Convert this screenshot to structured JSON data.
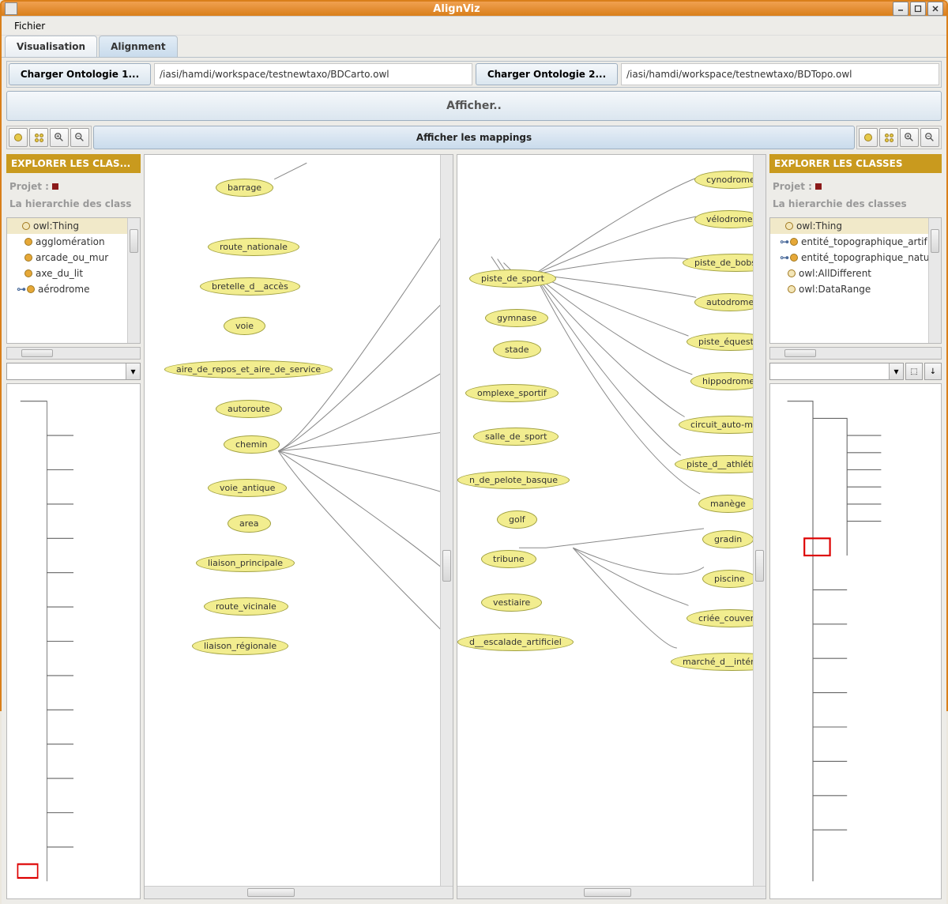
{
  "window": {
    "title": "AlignViz"
  },
  "menubar": {
    "file": "Fichier"
  },
  "tabs": {
    "visualisation": "Visualisation",
    "alignment": "Alignment",
    "active": "alignment"
  },
  "loaders": {
    "btn1": "Charger Ontologie 1...",
    "path1": "/iasi/hamdi/workspace/testnewtaxo/BDCarto.owl",
    "btn2": "Charger Ontologie 2...",
    "path2": "/iasi/hamdi/workspace/testnewtaxo/BDTopo.owl"
  },
  "buttons": {
    "afficher": "Afficher..",
    "mappings": "Afficher les mappings"
  },
  "explorer_left": {
    "header": "EXPLORER LES CLAS...",
    "projet": "Projet :",
    "hierarchy": "La hierarchie des class",
    "items": [
      "owl:Thing",
      "agglomération",
      "arcade_ou_mur",
      "axe_du_lit",
      "aérodrome"
    ]
  },
  "explorer_right": {
    "header": "EXPLORER LES CLASSES",
    "projet": "Projet :",
    "hierarchy": "La hierarchie des classes",
    "items": [
      "owl:Thing",
      "entité_topographique_artif",
      "entité_topographique_natu",
      "owl:AllDifferent",
      "owl:DataRange"
    ]
  },
  "graph_left": {
    "nodes": [
      "barrage",
      "route_nationale",
      "bretelle_d__accès",
      "voie",
      "aire_de_repos_et_aire_de_service",
      "autoroute",
      "chemin",
      "voie_antique",
      "area",
      "liaison_principale",
      "route_vicinale",
      "liaison_régionale"
    ]
  },
  "graph_right_col1": {
    "nodes": [
      "piste_de_sport",
      "gymnase",
      "stade",
      "omplexe_sportif",
      "salle_de_sport",
      "n_de_pelote_basque",
      "golf",
      "tribune",
      "vestiaire",
      "d__escalade_artificiel"
    ]
  },
  "graph_right_col2": {
    "nodes": [
      "cynodrome",
      "vélodrome",
      "piste_de_bobsleigh",
      "autodrome",
      "piste_équestre",
      "hippodrome",
      "circuit_auto-moto",
      "piste_d__athlétisme",
      "manège",
      "gradin",
      "piscine",
      "criée_couverte",
      "marché_d__intérêt_nat"
    ]
  }
}
